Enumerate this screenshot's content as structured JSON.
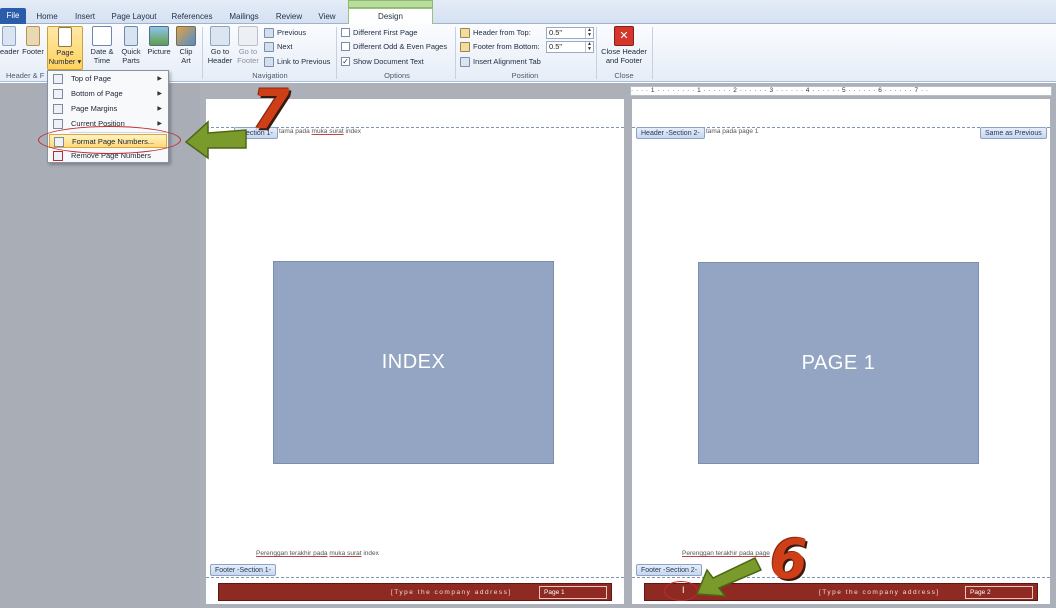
{
  "tabs": [
    "File",
    "Home",
    "Insert",
    "Page Layout",
    "References",
    "Mailings",
    "Review",
    "View",
    "Design"
  ],
  "groups": {
    "header_footer": {
      "label": "Header & F",
      "header_btn": "eader",
      "footer_btn": "Footer",
      "page_number_btn": "Page Number"
    },
    "insert": {
      "date_time": "Date & Time",
      "quick_parts": "Quick Parts",
      "picture": "Picture",
      "clip_art": "Clip Art"
    },
    "navigation": {
      "label": "Navigation",
      "go_to_header": "Go to Header",
      "go_to_footer": "Go to Footer",
      "previous": "Previous",
      "next": "Next",
      "link_to_previous": "Link to Previous"
    },
    "options": {
      "label": "Options",
      "different_first_page": "Different First Page",
      "different_odd_even": "Different Odd & Even Pages",
      "show_document_text": "Show Document Text",
      "show_document_text_checked": true
    },
    "position": {
      "label": "Position",
      "header_from_top": "Header from Top:",
      "header_from_top_value": "0.5\"",
      "footer_from_bottom": "Footer from Bottom:",
      "footer_from_bottom_value": "0.5\"",
      "insert_alignment_tab": "Insert Alignment Tab"
    },
    "close": {
      "label": "Close",
      "close_header_footer": "Close Header and Footer"
    }
  },
  "menu": {
    "items": [
      "Top of Page",
      "Bottom of Page",
      "Page Margins",
      "Current Position",
      "Format Page Numbers...",
      "Remove Page Numbers"
    ]
  },
  "ruler_text": "· · · · 1 · · · · · · · · 1 · · · · · · 2 · · · · · · 3 · · · · · · 4 · · · · · · 5 · · · · · · 6 · · · · · · 7 · ·",
  "page1": {
    "header_tag": "-Section 1-",
    "header_text_a": "tama pada",
    "header_text_b": "muka surat",
    "header_text_c": "index",
    "box_text": "INDEX",
    "footer_para_a": "Perenggan terakhir pada",
    "footer_para_b": "muka surat",
    "footer_para_c": "index",
    "footer_tag": "Footer -Section 1-",
    "address": "[Type the company address]",
    "page_label": "Page 1"
  },
  "page2": {
    "header_tag": "Header -Section 2-",
    "header_text_a": "tama pada",
    "header_text_b": "page 1",
    "same_as_previous": "Same as Previous",
    "box_text": "PAGE 1",
    "footer_para": "Perenggan terakhir pada page",
    "footer_tag": "Footer -Section 2-",
    "cursor": "I",
    "address": "[Type the company address]",
    "page_label": "Page 2"
  },
  "annotations": {
    "step_a": "7",
    "step_b": "6"
  },
  "colors": {
    "accent_green": "#7a9a2c",
    "footer_red": "#8e2a22",
    "highlight_oval": "#c0292b",
    "box_blue": "#93a5c3"
  }
}
